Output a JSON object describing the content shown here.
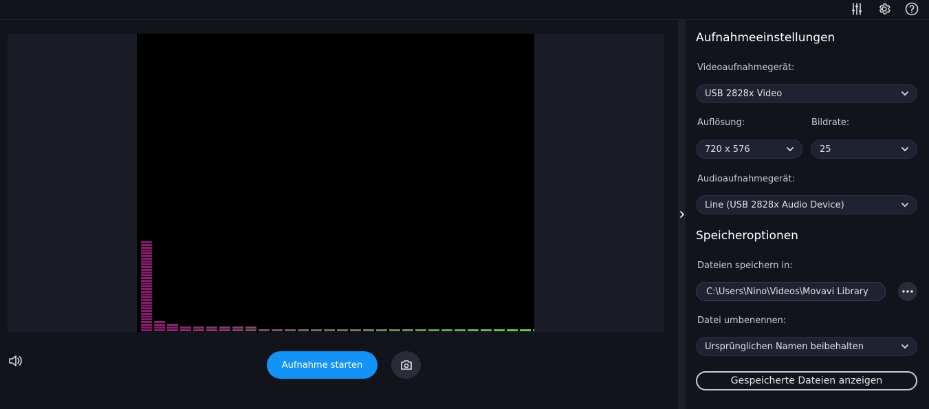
{
  "toolbar": {
    "icons": [
      "equalizer-icon",
      "gear-icon",
      "help-icon"
    ]
  },
  "preview": {
    "level_meter": {
      "bands": [
        0.3,
        0.035,
        0.025,
        0.02,
        0.018,
        0.016,
        0.016,
        0.015,
        0.014,
        0.013,
        0.012,
        0.012,
        0.012,
        0.011,
        0.011,
        0.011,
        0.011,
        0.011,
        0.01,
        0.01,
        0.01,
        0.01,
        0.01,
        0.01,
        0.01,
        0.01,
        0.01,
        0.01,
        0.01,
        0.01,
        0.01
      ]
    }
  },
  "controls": {
    "start_label": "Aufnahme starten"
  },
  "capture_settings": {
    "title": "Aufnahmeeinstellungen",
    "video_device_label": "Videoaufnahmegerät:",
    "video_device_value": "USB 2828x Video",
    "resolution_label": "Auflösung:",
    "resolution_value": "720 x 576",
    "framerate_label": "Bildrate:",
    "framerate_value": "25",
    "audio_device_label": "Audioaufnahmegerät:",
    "audio_device_value": "Line (USB 2828x Audio Device)"
  },
  "save_options": {
    "title": "Speicheroptionen",
    "save_in_label": "Dateien speichern in:",
    "save_path": "C:\\Users\\Nino\\Videos\\Movavi Library",
    "rename_label": "Datei umbenennen:",
    "rename_value": "Ursprünglichen Namen beibehalten",
    "show_files_label": "Gespeicherte Dateien anzeigen"
  },
  "colors": {
    "accent": "#1393f5",
    "meter_low": "#8a1a6e",
    "meter_high": "#5fd05a"
  }
}
